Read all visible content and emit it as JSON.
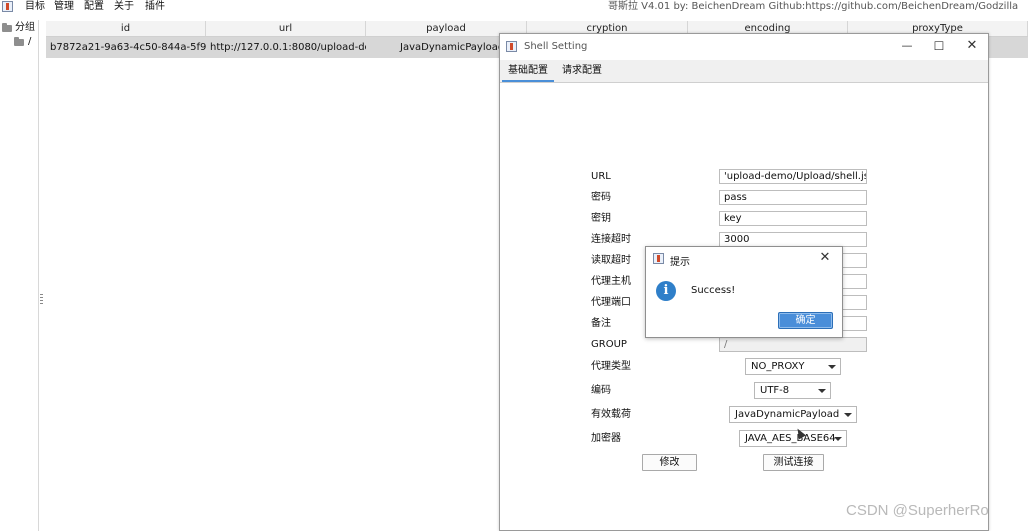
{
  "menu": {
    "items": [
      "目标",
      "管理",
      "配置",
      "关于",
      "插件"
    ],
    "window_title": "哥斯拉    V4.01 by: BeichenDream Github:https://github.com/BeichenDream/Godzilla"
  },
  "tree": {
    "root": "分组",
    "child": "/"
  },
  "table": {
    "columns": [
      "id",
      "url",
      "payload",
      "cryption",
      "encoding",
      "proxyType"
    ],
    "rows": [
      {
        "id": "b7872a21-9a63-4c50-844a-5f94d...",
        "url": "http://127.0.0.1:8080/upload-dem...",
        "payload": "JavaDynamicPayload"
      }
    ]
  },
  "shell_setting": {
    "title": "Shell Setting",
    "tabs": [
      "基础配置",
      "请求配置"
    ],
    "fields": {
      "url_label": "URL",
      "url_value": "'upload-demo/Upload/shell.jsp",
      "password_label": "密码",
      "password_value": "pass",
      "key_label": "密钥",
      "key_value": "key",
      "conn_timeout_label": "连接超时",
      "conn_timeout_value": "3000",
      "read_timeout_label": "读取超时",
      "proxy_host_label": "代理主机",
      "proxy_port_label": "代理端口",
      "remark_label": "备注",
      "group_label": "GROUP",
      "group_value": "/",
      "proxy_type_label": "代理类型",
      "proxy_type_value": "NO_PROXY",
      "encoding_label": "编码",
      "encoding_value": "UTF-8",
      "payload_label": "有效载荷",
      "payload_value": "JavaDynamicPayload",
      "cryption_label": "加密器",
      "cryption_value": "JAVA_AES_BASE64"
    },
    "buttons": {
      "modify": "修改",
      "test": "测试连接"
    }
  },
  "dialog": {
    "title": "提示",
    "message": "Success!",
    "ok": "确定"
  },
  "watermark": "CSDN @SuperherRo",
  "colors": {
    "accent": "#4a8ed9",
    "selected_row": "#d7d7d7",
    "info_icon": "#2f7fc9"
  }
}
